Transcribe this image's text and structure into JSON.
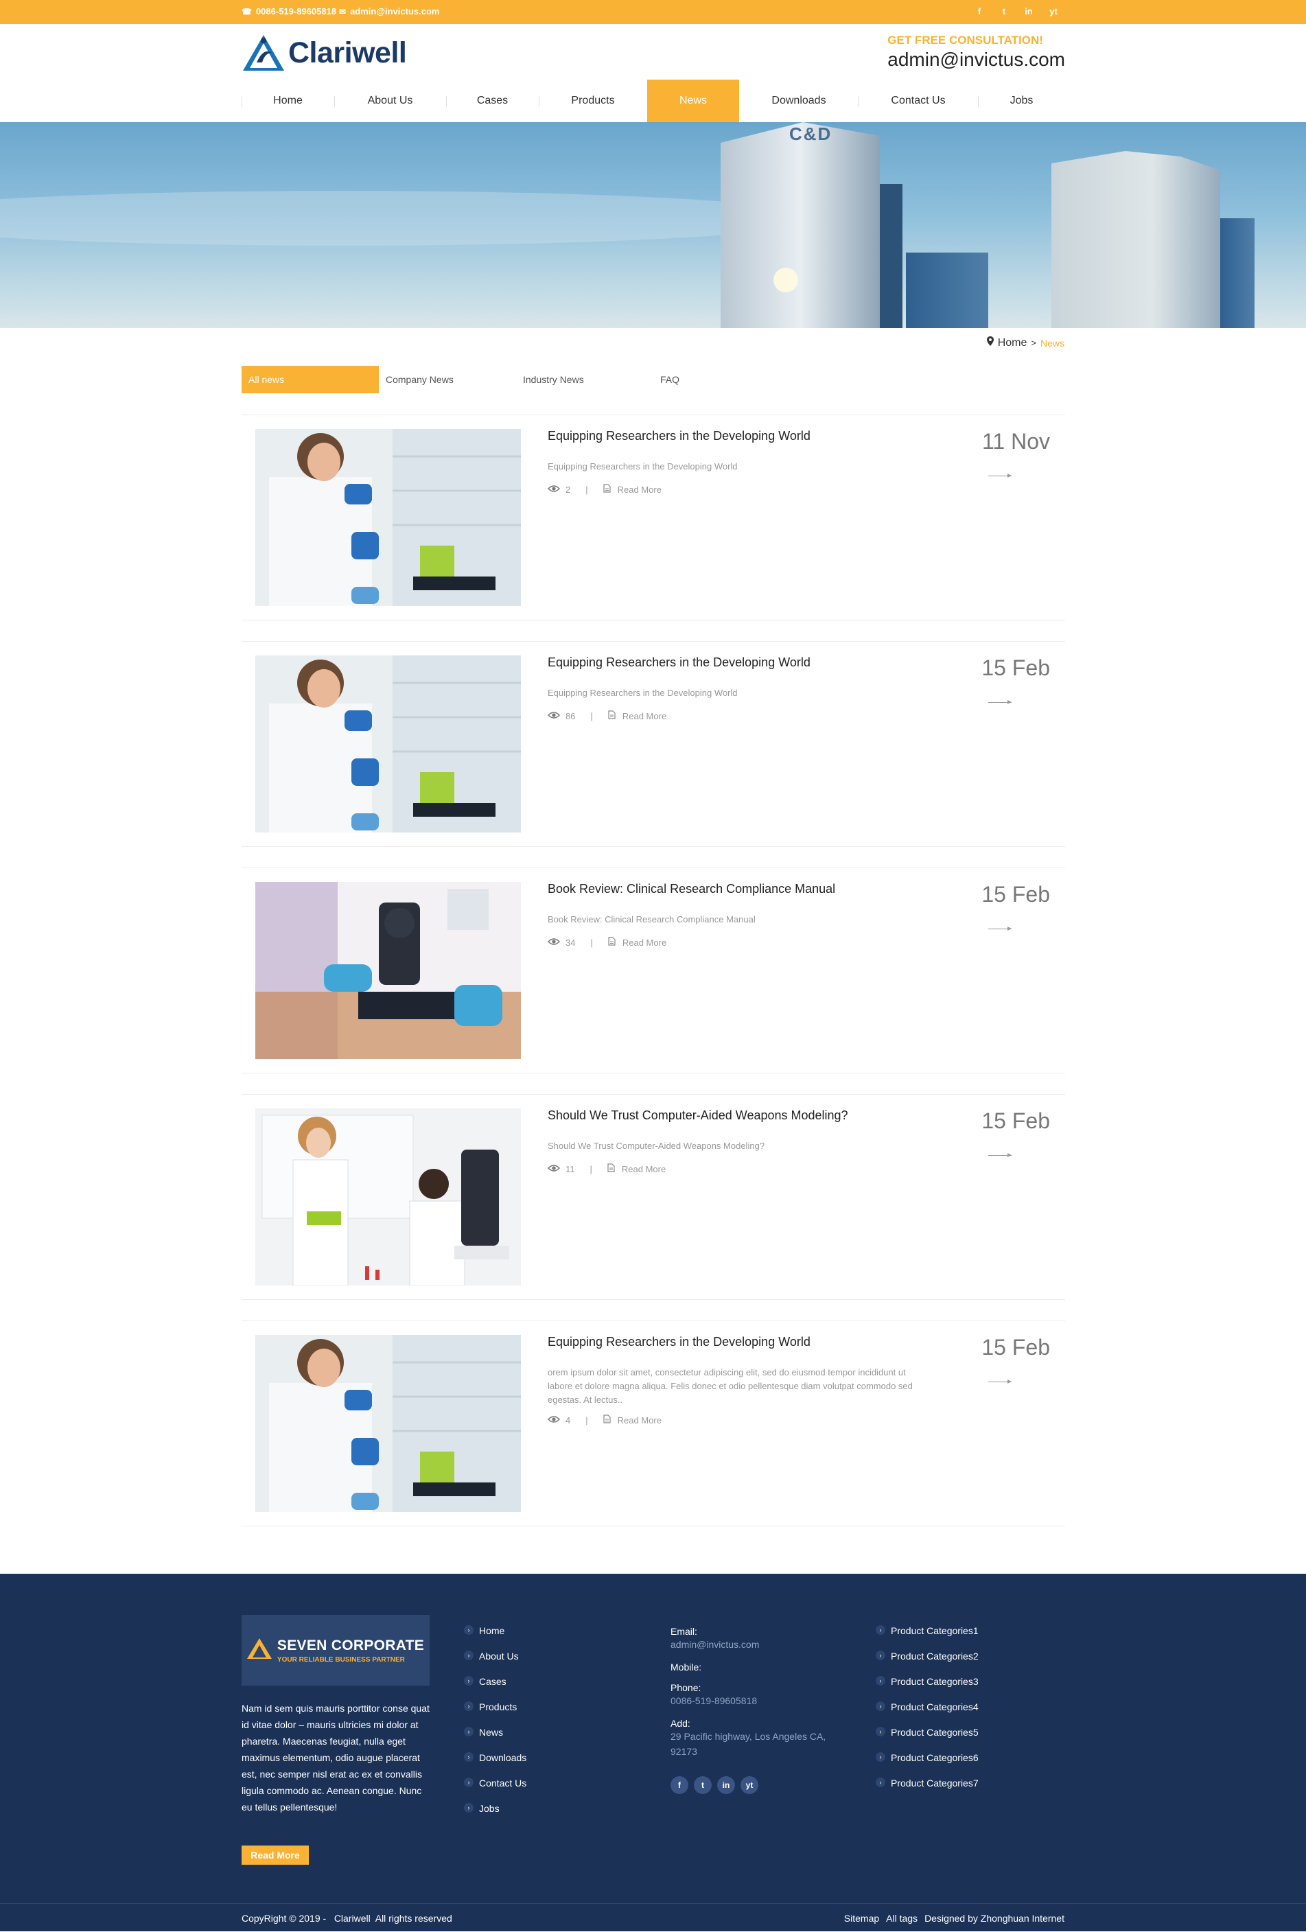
{
  "topbar": {
    "phone": "0086-519-89605818",
    "email": "admin@invictus.com",
    "social": [
      "f",
      "t",
      "in",
      "yt"
    ]
  },
  "header": {
    "brand": "Clariwell",
    "consult_label": "GET FREE CONSULTATION!",
    "consult_email": "admin@invictus.com"
  },
  "nav": {
    "items": [
      {
        "label": "Home"
      },
      {
        "label": "About Us"
      },
      {
        "label": "Cases"
      },
      {
        "label": "Products"
      },
      {
        "label": "News"
      },
      {
        "label": "Downloads"
      },
      {
        "label": "Contact Us"
      },
      {
        "label": "Jobs"
      }
    ],
    "active": "News"
  },
  "banner": {
    "building_sign": "C&D"
  },
  "breadcrumb": {
    "home": "Home",
    "separator": ">",
    "current": "News"
  },
  "tabs": [
    {
      "label": "All news"
    },
    {
      "label": "Company News"
    },
    {
      "label": "Industry News"
    },
    {
      "label": "FAQ"
    }
  ],
  "news": [
    {
      "title": "Equipping Researchers in the Developing World",
      "desc": "Equipping Researchers in the Developing World",
      "views": "2",
      "read_more": "Read More",
      "date": "11 Nov",
      "image": "lab-researcher"
    },
    {
      "title": "Equipping Researchers in the Developing World",
      "desc": "Equipping Researchers in the Developing World",
      "views": "86",
      "read_more": "Read More",
      "date": "15 Feb",
      "image": "lab-researcher"
    },
    {
      "title": "Book Review: Clinical Research Compliance Manual",
      "desc": "Book Review: Clinical Research Compliance Manual",
      "views": "34",
      "read_more": "Read More",
      "date": "15 Feb",
      "image": "microscope"
    },
    {
      "title": "Should We Trust Computer-Aided Weapons Modeling?",
      "desc": "Should We Trust Computer-Aided Weapons Modeling?",
      "views": "11",
      "read_more": "Read More",
      "date": "15 Feb",
      "image": "lab-women"
    },
    {
      "title": "Equipping Researchers in the Developing World",
      "desc": "orem ipsum dolor sit amet, consectetur adipiscing elit, sed do eiusmod tempor incididunt ut labore et dolore magna aliqua. Felis donec et odio pellentesque diam volutpat commodo sed egestas. At lectus..",
      "views": "4",
      "read_more": "Read More",
      "date": "15 Feb",
      "image": "lab-researcher"
    }
  ],
  "footer": {
    "logo_title": "SEVEN CORPORATE",
    "logo_sub": "YOUR RELIABLE BUSINESS PARTNER",
    "about": "Nam id sem quis mauris porttitor conse quat id vitae dolor – mauris ultricies mi dolor at pharetra. Maecenas feugiat, nulla eget maximus elementum, odio augue placerat est, nec semper nisl erat ac ex et convallis ligula commodo ac. Aenean congue. Nunc eu tellus pellentesque!",
    "read_more": "Read More",
    "links": [
      "Home",
      "About Us",
      "Cases",
      "Products",
      "News",
      "Downloads",
      "Contact Us",
      "Jobs"
    ],
    "contact": {
      "email_label": "Email:",
      "email": "admin@invictus.com",
      "mobile_label": "Mobile:",
      "mobile": "",
      "phone_label": "Phone:",
      "phone": "0086-519-89605818",
      "add_label": "Add:",
      "address": "29 Pacific highway, Los Angeles CA, 92173"
    },
    "social": [
      "f",
      "t",
      "in",
      "yt"
    ],
    "categories": [
      "Product Categories1",
      "Product Categories2",
      "Product Categories3",
      "Product Categories4",
      "Product Categories5",
      "Product Categories6",
      "Product Categories7"
    ],
    "copyright": "CopyRight © 2019 -   Clariwell  All rights reserved",
    "bottom_links": [
      "Sitemap",
      "All tags",
      "Designed by Zhonghuan Internet"
    ]
  },
  "colors": {
    "accent": "#f9b233",
    "navy": "#1b3155",
    "brand_blue": "#1b3a66"
  }
}
